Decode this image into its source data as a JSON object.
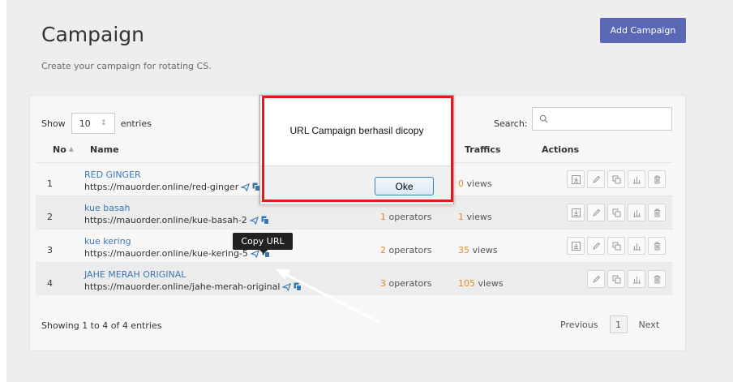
{
  "page": {
    "title": "Campaign",
    "subtitle": "Create your campaign for rotating CS.",
    "add_button": "Add Campaign"
  },
  "table": {
    "show_label": "Show",
    "page_length": "10",
    "entries_label": "entries",
    "search_label": "Search:",
    "headers": {
      "no": "No",
      "name": "Name",
      "traffics": "Traffics",
      "actions": "Actions"
    },
    "rows": [
      {
        "no": "1",
        "name": "RED GINGER",
        "url": "https://mauorder.online/red-ginger",
        "operators_count": "",
        "operators_label": "",
        "views_count": "0",
        "views_label": " views"
      },
      {
        "no": "2",
        "name": "kue basah",
        "url": "https://mauorder.online/kue-basah-2",
        "operators_count": "1",
        "operators_label": " operators",
        "views_count": "1",
        "views_label": " views"
      },
      {
        "no": "3",
        "name": "kue kering",
        "url": "https://mauorder.online/kue-kering-5",
        "operators_count": "2",
        "operators_label": " operators",
        "views_count": "35",
        "views_label": " views"
      },
      {
        "no": "4",
        "name": "JAHE MERAH ORIGINAL",
        "url": "https://mauorder.online/jahe-merah-original",
        "operators_count": "3",
        "operators_label": " operators",
        "views_count": "105",
        "views_label": " views"
      }
    ],
    "footer_info": "Showing 1 to 4 of 4 entries",
    "pagination": {
      "previous": "Previous",
      "current": "1",
      "next": "Next"
    }
  },
  "tooltip": "Copy URL",
  "dialog": {
    "message": "URL Campaign berhasil dicopy",
    "ok_button": "Oke"
  },
  "colors": {
    "accent": "#5b68b6",
    "link": "#3a78b4",
    "count": "#e08b2c",
    "highlight": "#e01b1b"
  },
  "icons": [
    "search-icon",
    "send-icon",
    "copy-icon",
    "download-icon",
    "edit-icon",
    "duplicate-icon",
    "stats-icon",
    "trash-icon",
    "sort-icon"
  ]
}
